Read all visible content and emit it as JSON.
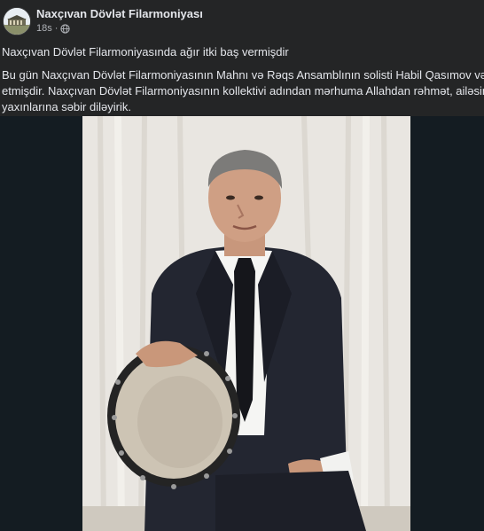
{
  "post": {
    "page_name": "Naxçıvan Dövlət Filarmoniyası",
    "time": "18s",
    "separator": "·",
    "audience_icon": "globe-icon",
    "headline": "Naxçıvan Dövlət Filarmoniyasında ağır itki baş vermişdir",
    "body_lines": [
      "Bu gün Naxçıvan Dövlət Filarmoniyasının Mahnı və Rəqs Ansamblının solisti Habil Qasımov vəfat",
      "etmişdir. Naxçıvan Dövlət Filarmoniyasının kollektivi adından mərhuma Allahdan rəhmət, ailəsinə və",
      "yaxınlarına səbir diləyirik."
    ]
  },
  "colors": {
    "background": "#242526",
    "text": "#e4e6eb",
    "secondary_text": "#b0b3b8",
    "photo_surround": "#141c22"
  }
}
